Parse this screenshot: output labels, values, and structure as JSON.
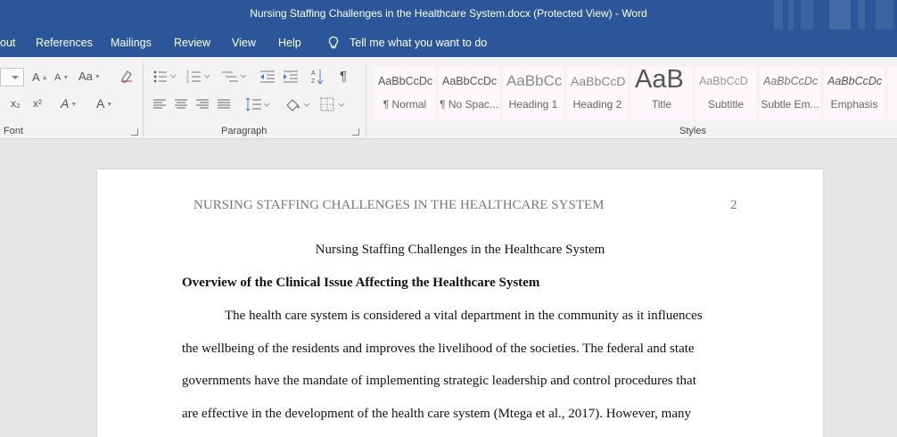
{
  "window": {
    "title": "Nursing Staffing Challenges in the Healthcare System.docx (Protected View)  -  Word"
  },
  "tabs": {
    "layout_partial": "out",
    "references": "References",
    "mailings": "Mailings",
    "review": "Review",
    "view": "View",
    "help": "Help",
    "tell_me": "Tell me what you want to do"
  },
  "ribbon": {
    "font_group": "Font",
    "paragraph_group": "Paragraph",
    "styles_group": "Styles",
    "font_buttons": {
      "grow": "A",
      "shrink": "A",
      "change_case": "Aa",
      "subscript": "x₂",
      "superscript": "x²",
      "text_effects": "A",
      "font_color": "A"
    },
    "paragraph_buttons": {
      "pilcrow": "¶"
    },
    "styles": [
      {
        "sample": "AaBbCcDc",
        "name": "¶ Normal"
      },
      {
        "sample": "AaBbCcDc",
        "name": "¶ No Spac..."
      },
      {
        "sample": "AaBbCc",
        "name": "Heading 1"
      },
      {
        "sample": "AaBbCcD",
        "name": "Heading 2"
      },
      {
        "sample": "AaB",
        "name": "Title"
      },
      {
        "sample": "AaBbCcD",
        "name": "Subtitle"
      },
      {
        "sample": "AaBbCcDc",
        "name": "Subtle Em..."
      },
      {
        "sample": "AaBbCcDc",
        "name": "Emphasis"
      }
    ],
    "colors": {
      "brand": "#2b579a",
      "ribbon_bg": "#f3f3f3"
    }
  },
  "document": {
    "running_head": "NURSING STAFFING CHALLENGES IN THE HEALTHCARE SYSTEM",
    "page_number": "2",
    "title": "Nursing Staffing Challenges in the Healthcare System",
    "heading": "Overview of the Clinical Issue Affecting the Healthcare System",
    "lines": [
      "The health care system is considered a vital department in the community as it influences",
      "the wellbeing of the residents and improves the livelihood of the societies. The federal and state",
      "governments have the mandate of implementing strategic leadership and control procedures that",
      "are effective in the development of the health care system (Mtega et al., 2017). However, many"
    ]
  }
}
